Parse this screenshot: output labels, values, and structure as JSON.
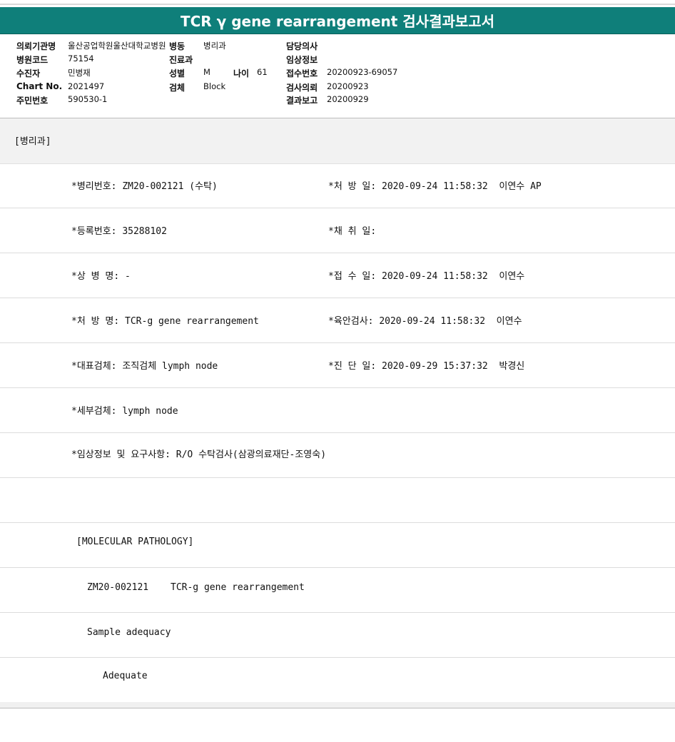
{
  "report": {
    "title": "TCR γ gene rearrangement 검사결과보고서"
  },
  "header": {
    "institution_label": "의뢰기관명",
    "institution_value": "울산공업학원울산대학교병원",
    "ward_label": "병동",
    "ward_value": "병리과",
    "doctor_label": "담당의사",
    "hospital_code_label": "병원코드",
    "hospital_code_value": "75154",
    "department_label": "진료과",
    "clinical_info_label": "임상정보",
    "patient_label": "수진자",
    "patient_value": "민병재",
    "sex_label": "성별",
    "sex_value": "M",
    "age_label": "나이",
    "age_value": "61",
    "receipt_no_label": "접수번호",
    "receipt_no_value": "20200923-69057",
    "chart_no_label": "Chart No.",
    "chart_no_value": "2021497",
    "specimen_label": "검체",
    "specimen_value": "Block",
    "request_date_label": "검사의뢰",
    "request_date_value": "20200923",
    "resident_no_label": "주민번호",
    "resident_no_value": "590530-1",
    "report_date_label": "결과보고",
    "report_date_value": "20200929"
  },
  "dept_section": "[병리과]",
  "details": {
    "pathology_no": "*병리번호: ZM20-002121 (수탁)",
    "order_date": "*처 방 일: 2020-09-24 11:58:32  이연수 AP",
    "registration_no": "*등록번호: 35288102",
    "collection_date": "*채 취 일:",
    "diagnosis_name": "*상 병 명: -",
    "receipt_date": "*접 수 일: 2020-09-24 11:58:32  이연수",
    "order_name": "*처 방 명: TCR-g gene rearrangement",
    "gross_exam": "*육안검사: 2020-09-24 11:58:32  이연수",
    "representative_specimen": "*대표검체: 조직검체 lymph node",
    "diagnosis_date": "*진 단 일: 2020-09-29 15:37:32  박경신",
    "detail_specimen": "*세부검체: lymph node",
    "clinical_request": "*임상정보 및 요구사항: R/O 수탁검사(삼광의료재단-조영숙)"
  },
  "results": {
    "section_header": "[MOLECULAR PATHOLOGY]",
    "case_no": "ZM20-002121",
    "test_name": "TCR-g gene rearrangement",
    "adequacy_label": "Sample adequacy",
    "adequacy_value": "Adequate"
  }
}
